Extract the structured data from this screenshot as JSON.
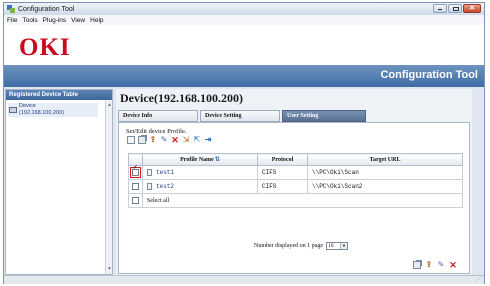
{
  "window": {
    "title": "Configuration Tool"
  },
  "menu": [
    "File",
    "Tools",
    "Plug-ins",
    "View",
    "Help"
  ],
  "banner": {
    "logo": "OKI",
    "title": "Configuration Tool"
  },
  "sidebar": {
    "header": "Registered Device Table",
    "items": [
      {
        "label": "Device",
        "sublabel": "(192.168.100.200)"
      }
    ]
  },
  "main": {
    "title": "Device(192.168.100.200)",
    "tabs": [
      {
        "label": "Device Info"
      },
      {
        "label": "Device Setting"
      },
      {
        "label": "User Setting"
      }
    ],
    "section_label": "Set/Edit device Profile.",
    "table": {
      "headers": [
        "Profile Name",
        "Protocol",
        "Target URL"
      ],
      "rows": [
        {
          "checked": true,
          "name": "test1",
          "protocol": "CIFS",
          "url": "\\\\PC\\Oki\\Scan"
        },
        {
          "checked": false,
          "name": "test2",
          "protocol": "CIFS",
          "url": "\\\\PC\\Oki\\Scan2"
        }
      ],
      "select_all": "Select all"
    },
    "pager": {
      "label": "Number displayed on 1 page",
      "value": "10"
    }
  },
  "colors": {
    "logo": "#cc0a1f",
    "banner": "#4f7aae",
    "highlight": "#d81b1b"
  },
  "icons": {
    "toolbar": [
      "new-profile-icon",
      "copy-profile-icon",
      "upload-icon",
      "edit-icon",
      "delete-icon",
      "import-icon",
      "export-icon",
      "move-icon"
    ],
    "bottom": [
      "copy-profile-icon",
      "upload-icon",
      "edit-icon",
      "delete-icon"
    ]
  }
}
